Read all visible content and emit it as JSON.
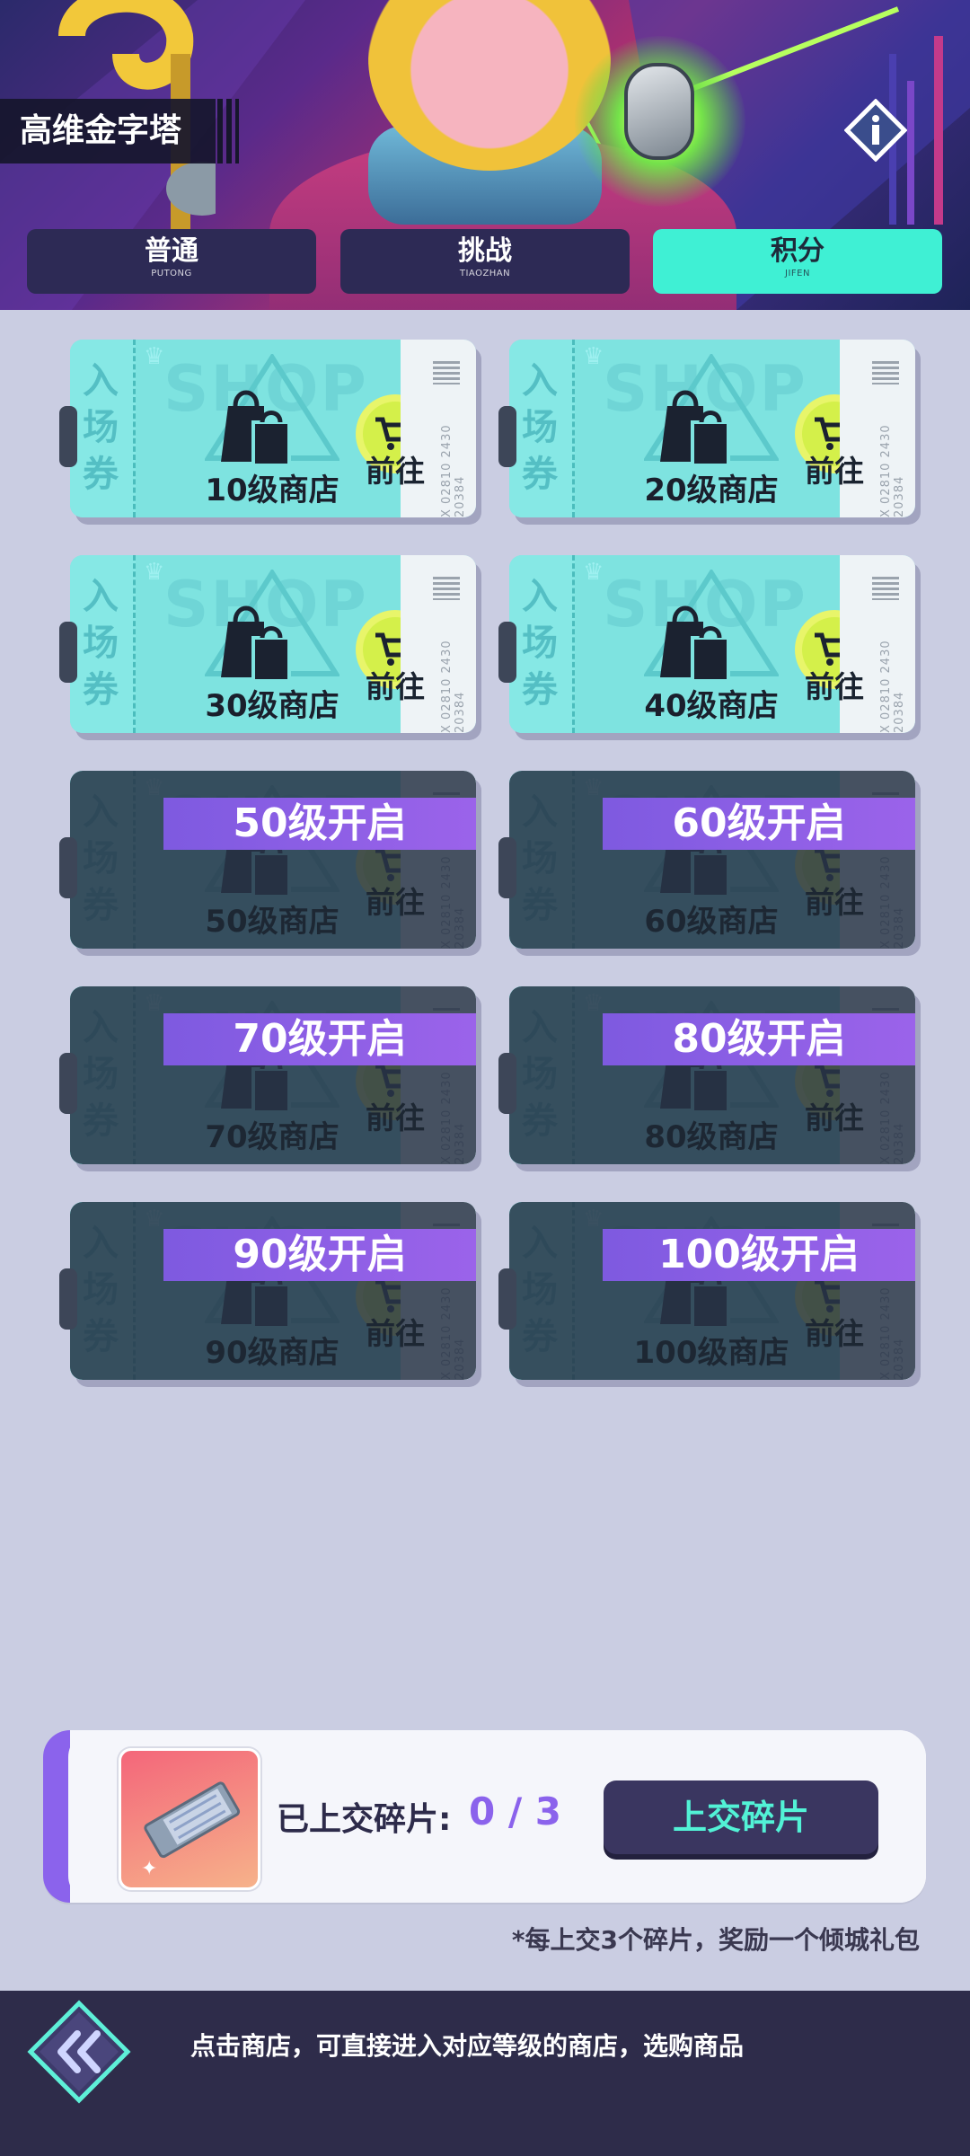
{
  "header": {
    "title": "高维金字塔",
    "tabs": [
      {
        "label": "普通",
        "sub": "PUTONG",
        "active": false
      },
      {
        "label": "挑战",
        "sub": "TIAOZHAN",
        "active": false
      },
      {
        "label": "积分",
        "sub": "JIFEN",
        "active": true
      }
    ],
    "info_icon": "info-icon"
  },
  "ticket_common": {
    "stub_text": "入场券",
    "watermark": "SHOP",
    "go_label": "前往",
    "serial": "X 02810 2430 20384"
  },
  "shops": [
    {
      "name": "10级商店",
      "unlocked": true,
      "lock_text": ""
    },
    {
      "name": "20级商店",
      "unlocked": true,
      "lock_text": ""
    },
    {
      "name": "30级商店",
      "unlocked": true,
      "lock_text": ""
    },
    {
      "name": "40级商店",
      "unlocked": true,
      "lock_text": ""
    },
    {
      "name": "50级商店",
      "unlocked": false,
      "lock_text": "50级开启"
    },
    {
      "name": "60级商店",
      "unlocked": false,
      "lock_text": "60级开启"
    },
    {
      "name": "70级商店",
      "unlocked": false,
      "lock_text": "70级开启"
    },
    {
      "name": "80级商店",
      "unlocked": false,
      "lock_text": "80级开启"
    },
    {
      "name": "90级商店",
      "unlocked": false,
      "lock_text": "90级开启"
    },
    {
      "name": "100级商店",
      "unlocked": false,
      "lock_text": "100级开启"
    }
  ],
  "fragments": {
    "label": "已上交碎片:",
    "count": "0 / 3",
    "button": "上交碎片",
    "note": "*每上交3个碎片，奖励一个倾城礼包"
  },
  "footer": {
    "hint": "点击商店，可直接进入对应等级的商店，选购商品",
    "back_icon": "double-chevron-left-icon"
  },
  "colors": {
    "active_tab": "#3ff0d4",
    "ticket": "#7ee3e0",
    "lock_banner": "#8b63ec",
    "submit_text": "#52f2d6"
  }
}
